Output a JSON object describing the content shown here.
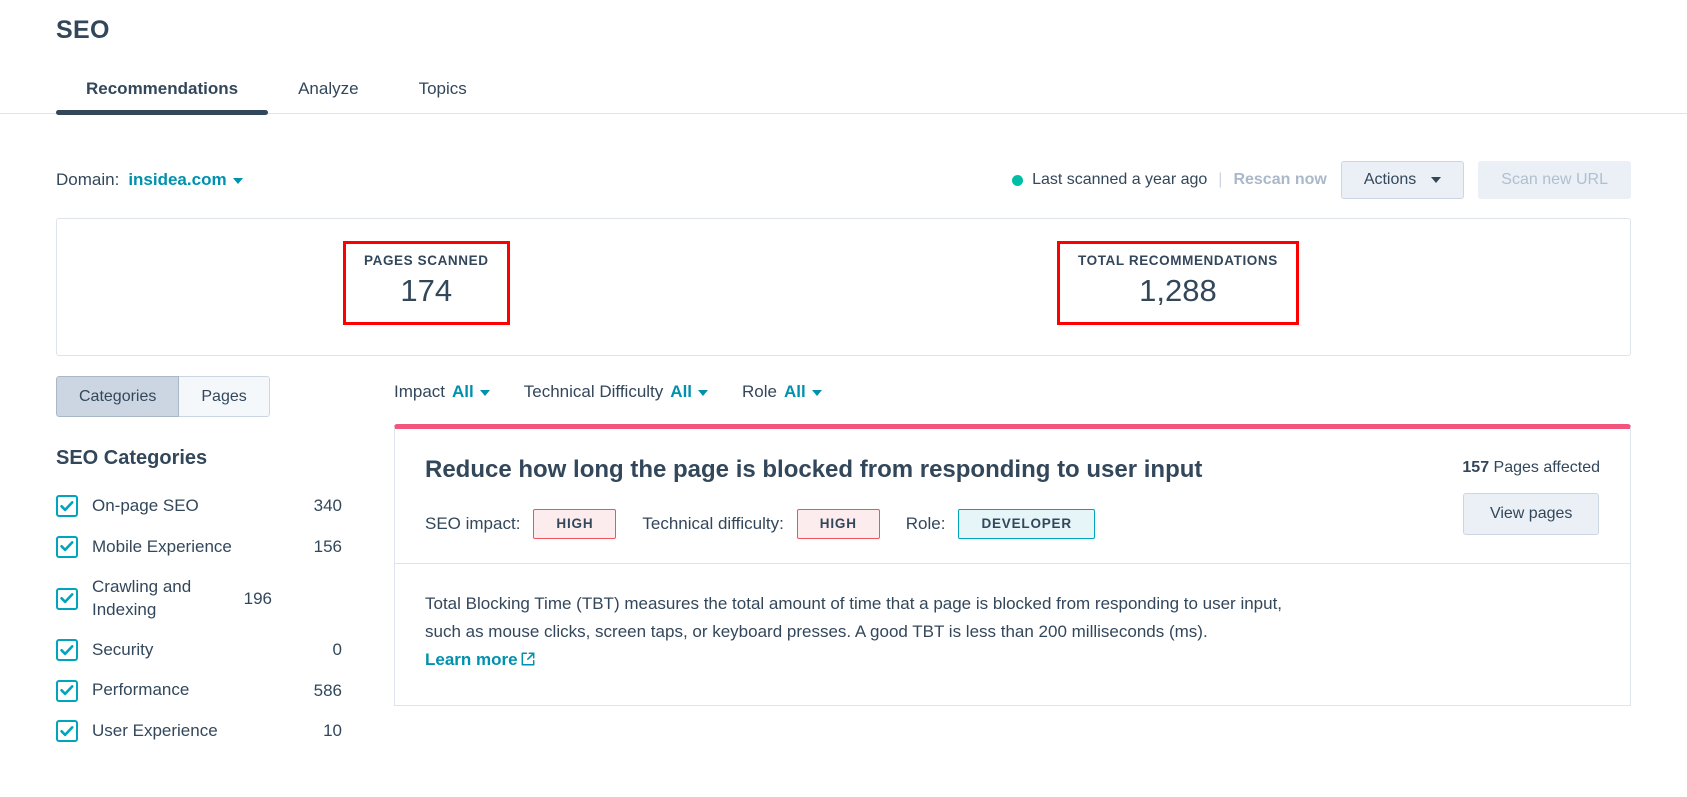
{
  "app": {
    "title": "SEO"
  },
  "tabs": [
    {
      "label": "Recommendations",
      "active": true
    },
    {
      "label": "Analyze",
      "active": false
    },
    {
      "label": "Topics",
      "active": false
    }
  ],
  "domain_bar": {
    "label": "Domain:",
    "value": "insidea.com",
    "scan_status": "Last scanned a year ago",
    "separator": "|",
    "rescan_link": "Rescan now",
    "actions_button": "Actions",
    "scan_new_url_button": "Scan new URL",
    "status_dot_color": "#00bda5"
  },
  "stats": [
    {
      "label": "PAGES SCANNED",
      "value": "174",
      "highlight_color": "#ff0000"
    },
    {
      "label": "TOTAL RECOMMENDATIONS",
      "value": "1,288",
      "highlight_color": "#ff0000"
    }
  ],
  "sidebar": {
    "toggle": [
      {
        "label": "Categories",
        "active": true
      },
      {
        "label": "Pages",
        "active": false
      }
    ],
    "title": "SEO Categories",
    "categories": [
      {
        "label": "On-page SEO",
        "count": "340",
        "checked": true
      },
      {
        "label": "Mobile Experience",
        "count": "156",
        "checked": true
      },
      {
        "label": "Crawling and Indexing",
        "count": "196",
        "checked": true
      },
      {
        "label": "Security",
        "count": "0",
        "checked": true
      },
      {
        "label": "Performance",
        "count": "586",
        "checked": true
      },
      {
        "label": "User Experience",
        "count": "10",
        "checked": true
      }
    ],
    "checkbox_color": "#00a4bd"
  },
  "filters": [
    {
      "label": "Impact",
      "value": "All"
    },
    {
      "label": "Technical Difficulty",
      "value": "All"
    },
    {
      "label": "Role",
      "value": "All"
    }
  ],
  "recommendation": {
    "accent_color": "#f2547d",
    "title": "Reduce how long the page is blocked from responding to user input",
    "impact_label": "SEO impact:",
    "impact_value": "HIGH",
    "difficulty_label": "Technical difficulty:",
    "difficulty_value": "HIGH",
    "role_label": "Role:",
    "role_value": "DEVELOPER",
    "pages_affected_count": "157",
    "pages_affected_text": "Pages affected",
    "view_pages_button": "View pages",
    "description": "Total Blocking Time (TBT) measures the total amount of time that a page is blocked from responding to user input, such as mouse clicks, screen taps, or keyboard presses. A good TBT is less than 200 milliseconds (ms).",
    "learn_more": "Learn more"
  }
}
